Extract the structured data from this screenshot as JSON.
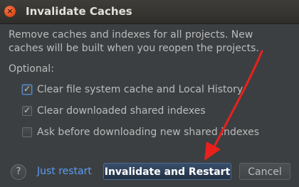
{
  "dialog": {
    "title": "Invalidate Caches",
    "description_lines": [
      "Remove caches and indexes for all projects. New",
      "caches will be built when you reopen the projects."
    ],
    "optional_label": "Optional:",
    "options": [
      {
        "label": "Clear file system cache and Local History",
        "checked": true
      },
      {
        "label": "Clear downloaded shared indexes",
        "checked": true
      },
      {
        "label": "Ask before downloading new shared indexes",
        "checked": false
      }
    ],
    "help_label": "?",
    "just_restart_label": "Just restart",
    "invalidate_restart_label": "Invalidate and Restart",
    "cancel_label": "Cancel",
    "close_symbol": "×"
  },
  "colors": {
    "background": "#3c3f41",
    "text": "#bbbbbb",
    "link": "#589df6",
    "close_button": "#dd4814",
    "annotation_arrow": "#e8211c"
  },
  "icons": {
    "close": "close-icon",
    "help": "question-mark-icon",
    "check": "checkmark-icon",
    "annotation": "red-arrow-annotation"
  }
}
